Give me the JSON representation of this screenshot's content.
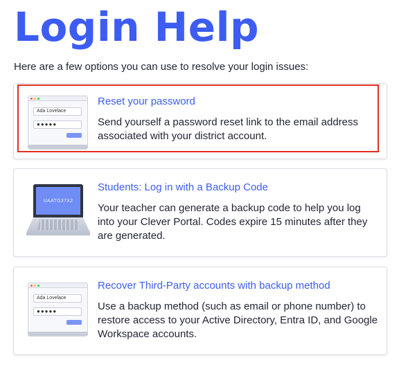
{
  "page": {
    "title": "Login Help",
    "intro": "Here are a few options you can use to resolve your login issues:"
  },
  "colors": {
    "accent": "#3d5cf2",
    "highlight_border": "#e0301e",
    "text": "#1f2433"
  },
  "cards": [
    {
      "heading": "Reset your password",
      "body": "Send yourself a password reset link to the email address associated with your district account.",
      "illustration": {
        "type": "browser-login",
        "name_field": "Ada Lovelace",
        "password_field": "●●●●●"
      },
      "highlighted": true
    },
    {
      "heading": "Students: Log in with a Backup Code",
      "body": "Your teacher can generate a backup code to help you log into your Clever Portal. Codes expire 15 minutes after they are generated.",
      "illustration": {
        "type": "laptop",
        "screen_text": "UAATG37X2"
      },
      "highlighted": false
    },
    {
      "heading": "Recover Third-Party accounts with backup method",
      "body": "Use a backup method (such as email or phone number) to restore access to your Active Directory, Entra ID, and Google Workspace accounts.",
      "illustration": {
        "type": "browser-login",
        "name_field": "Ada Lovelace",
        "password_field": "●●●●●"
      },
      "highlighted": false
    }
  ]
}
